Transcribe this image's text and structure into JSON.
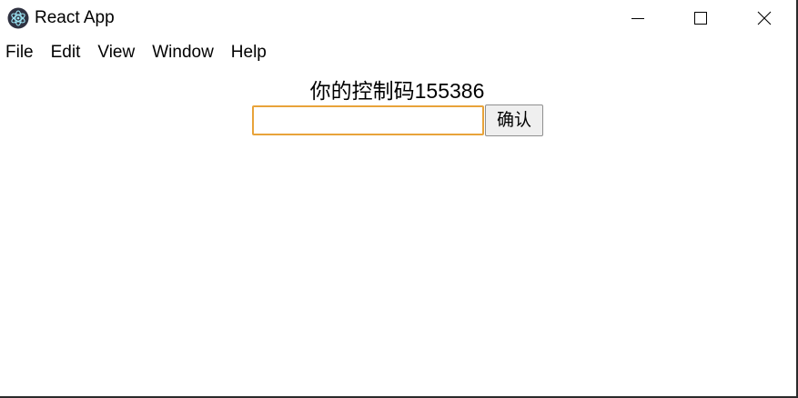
{
  "window": {
    "title": "React App",
    "controls": {
      "minimize": "minimize-icon",
      "maximize": "maximize-icon",
      "close": "close-icon"
    }
  },
  "menu": {
    "items": [
      {
        "label": "File"
      },
      {
        "label": "Edit"
      },
      {
        "label": "View"
      },
      {
        "label": "Window"
      },
      {
        "label": "Help"
      }
    ]
  },
  "main": {
    "control_code_text": "你的控制码155386",
    "input": {
      "value": "",
      "placeholder": ""
    },
    "confirm_label": "确认"
  },
  "colors": {
    "input_focus_border": "#e8a33a",
    "window_border": "#2b2b2b",
    "button_bg": "#efefef"
  }
}
